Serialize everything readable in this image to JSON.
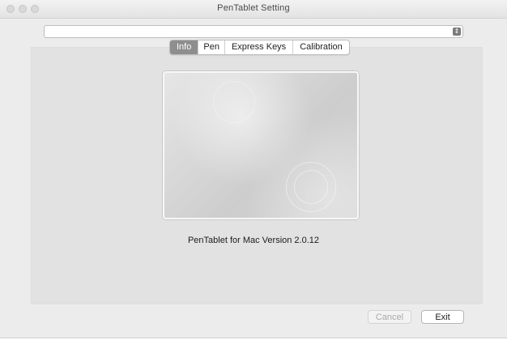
{
  "window": {
    "title": "PenTablet Setting"
  },
  "tablet_select": {
    "value": ""
  },
  "tabs": [
    {
      "label": "Info",
      "active": true
    },
    {
      "label": "Pen",
      "active": false
    },
    {
      "label": "Express Keys",
      "active": false
    },
    {
      "label": "Calibration",
      "active": false
    }
  ],
  "info": {
    "version_text": "PenTablet for Mac Version 2.0.12"
  },
  "buttons": {
    "cancel": "Cancel",
    "exit": "Exit"
  },
  "colors": {
    "active_tab": "#8e8e8e",
    "panel": "#e2e2e2",
    "window": "#ececec"
  }
}
